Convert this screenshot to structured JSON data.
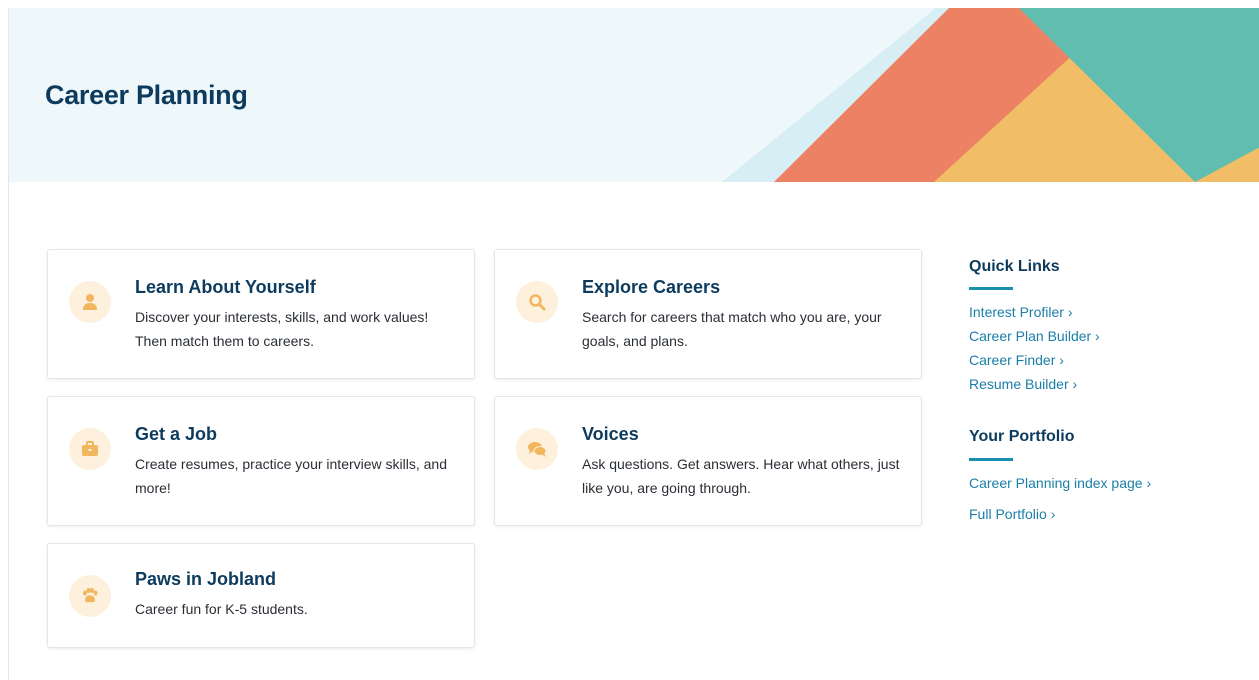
{
  "header": {
    "title": "Career Planning",
    "colors": {
      "background": "#eef7fa",
      "light_blue": "#d6eef4",
      "orange": "#ec8163",
      "yellow": "#f2bd67",
      "teal": "#62bdb1"
    }
  },
  "cards": [
    {
      "title": "Learn About Yourself",
      "description": "Discover your interests, skills, and work values! Then match them to careers.",
      "icon": "person-icon"
    },
    {
      "title": "Explore Careers",
      "description": "Search for careers that match who you are, your goals, and plans.",
      "icon": "search-icon"
    },
    {
      "title": "Get a Job",
      "description": "Create resumes, practice your interview skills, and more!",
      "icon": "briefcase-icon"
    },
    {
      "title": "Voices",
      "description": "Ask questions. Get answers. Hear what others, just like you, are going through.",
      "icon": "chat-bubbles-icon"
    },
    {
      "title": "Paws in Jobland",
      "description": "Career fun for K-5 students.",
      "icon": "paw-icon"
    }
  ],
  "quick_links": {
    "heading": "Quick Links",
    "links": [
      "Interest Profiler ›",
      "Career Plan Builder ›",
      "Career Finder ›",
      "Resume Builder ›"
    ]
  },
  "portfolio": {
    "heading": "Your Portfolio",
    "links": [
      "Career Planning index page ›",
      "Full Portfolio ›"
    ]
  },
  "colors": {
    "accent": "#1a7fa8",
    "title": "#0d3b5e",
    "icon_bg": "#fdf0dc",
    "icon_fg": "#f2b65e"
  }
}
